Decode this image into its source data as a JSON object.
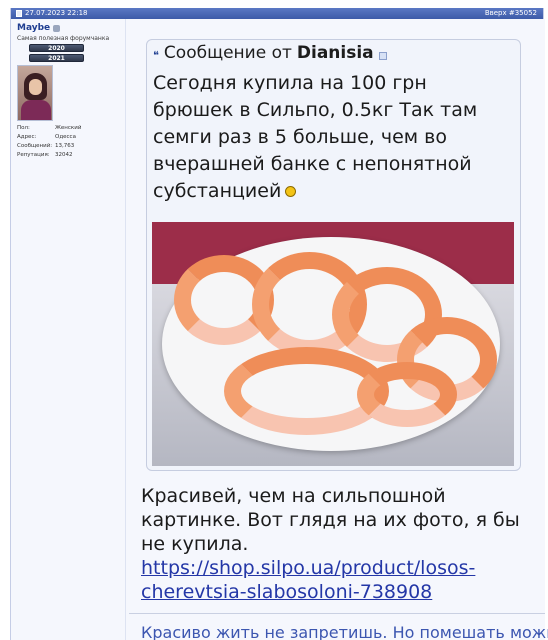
{
  "post": {
    "date": "27.07.2023 22:18",
    "top_link": "Вверх #35052"
  },
  "user": {
    "name": "Maybe",
    "title": "Самая полезная форумчанка",
    "awards": [
      "2020",
      "2021"
    ],
    "info": [
      {
        "key": "Пол:",
        "value": "Женский"
      },
      {
        "key": "Адрес:",
        "value": "Одесса"
      },
      {
        "key": "Сообщений:",
        "value": "13,763"
      },
      {
        "key": "Репутация:",
        "value": "32042"
      }
    ]
  },
  "quote": {
    "prefix": "Сообщение от",
    "author": "Dianisia",
    "text": "Сегодня купила на 100 грн брюшек в Сильпо, 0.5кг Так там семги раз в 5 больше, чем во вчерашней банке с непонятной субстанцией"
  },
  "reply": {
    "text": "Красивей, чем на сильпошной картинке. Вот глядя на их фото, я бы не купила.",
    "link": "https://shop.silpo.ua/product/losos-cherevtsia-slabosoloni-738908"
  },
  "signature": "Красиво жить не запретишь. Но помешать можно.",
  "colors": {
    "header": "#3d5ba8",
    "link": "#2437a7",
    "signature": "#3c56b0"
  }
}
